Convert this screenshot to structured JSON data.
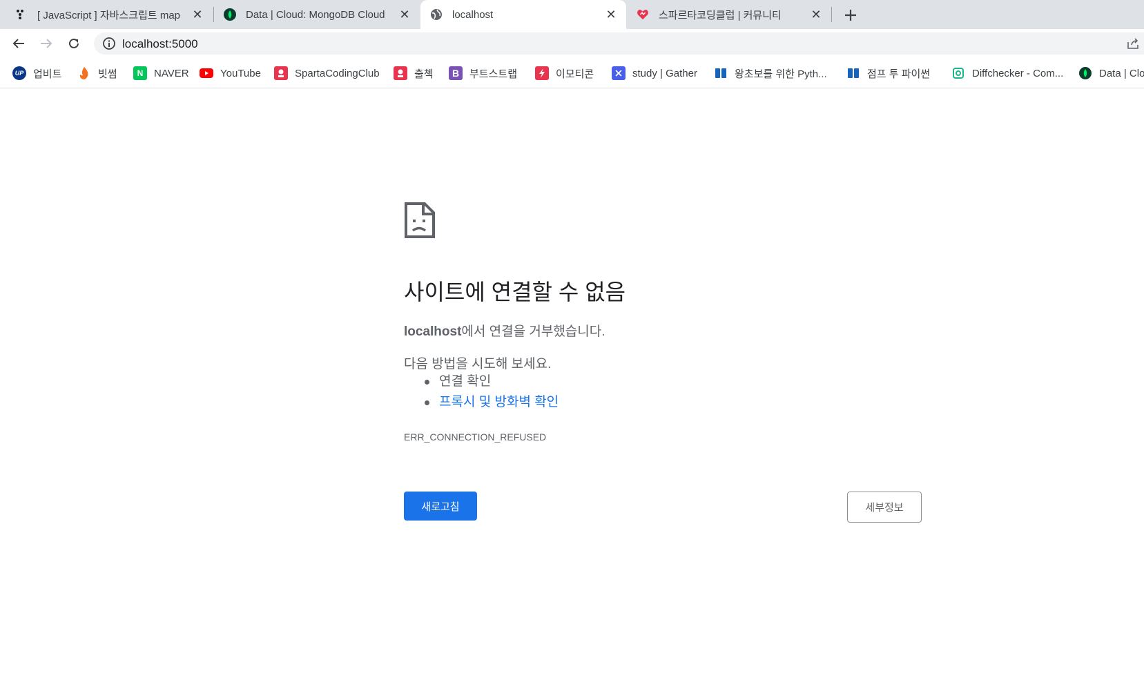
{
  "tabs": [
    {
      "title": "[ JavaScript ] 자바스크립트 map",
      "icon": "velog-dots-icon"
    },
    {
      "title": "Data | Cloud: MongoDB Cloud",
      "icon": "mongodb-leaf-icon"
    },
    {
      "title": "localhost",
      "icon": "globe-icon",
      "active": true
    },
    {
      "title": "스파르타코딩클럽 | 커뮤니티",
      "icon": "sparta-icon"
    }
  ],
  "toolbar": {
    "url": "localhost:5000"
  },
  "bookmarks": [
    {
      "label": "업비트",
      "icon": "upbit-icon",
      "color": "#093687"
    },
    {
      "label": "빗썸",
      "icon": "bithumb-icon",
      "color": "#f37321"
    },
    {
      "label": "NAVER",
      "icon": "naver-icon",
      "color": "#03c75a"
    },
    {
      "label": "YouTube",
      "icon": "youtube-icon",
      "color": "#ff0000"
    },
    {
      "label": "SpartaCodingClub",
      "icon": "sparta-icon",
      "color": "#e8344e"
    },
    {
      "label": "출첵",
      "icon": "sparta-icon",
      "color": "#e8344e"
    },
    {
      "label": "부트스트랩",
      "icon": "bootstrap-icon",
      "color": "#7952b3"
    },
    {
      "label": "이모티콘",
      "icon": "emoticon-icon",
      "color": "#e8344e"
    },
    {
      "label": "study | Gather",
      "icon": "gather-icon",
      "color": "#4a5fe8"
    },
    {
      "label": "왕초보를 위한 Pyth...",
      "icon": "wikidocs-icon",
      "color": "#1565c0"
    },
    {
      "label": "점프 투 파이썬",
      "icon": "wikidocs-icon",
      "color": "#1565c0"
    },
    {
      "label": "Diffchecker - Com...",
      "icon": "diffchecker-icon",
      "color": "#1bb58e"
    },
    {
      "label": "Data | Clo",
      "icon": "mongodb-leaf-icon",
      "color": "#0b3d2e"
    }
  ],
  "error": {
    "title": "사이트에 연결할 수 없음",
    "host": "localhost",
    "message": "에서 연결을 거부했습니다.",
    "try_title": "다음 방법을 시도해 보세요.",
    "suggestions": [
      "연결 확인",
      "프록시 및 방화벽 확인"
    ],
    "code": "ERR_CONNECTION_REFUSED",
    "reload_label": "새로고침",
    "details_label": "세부정보"
  },
  "colors": {
    "accent": "#1a73e8",
    "tabstrip": "#dee1e6",
    "text_secondary": "#5f6368"
  }
}
